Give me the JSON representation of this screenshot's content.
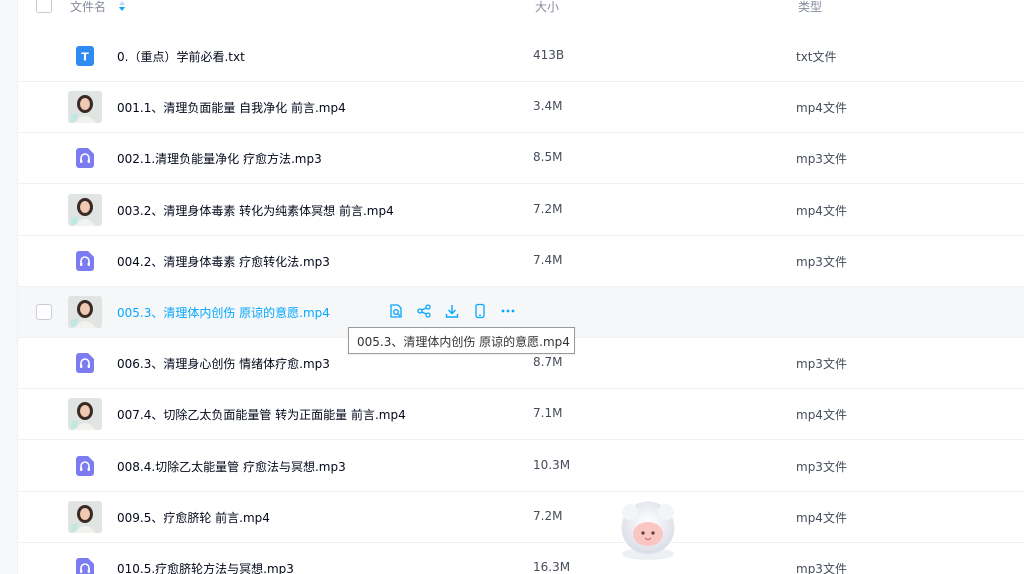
{
  "header": {
    "name_label": "文件名",
    "size_label": "大小",
    "type_label": "类型"
  },
  "files": [
    {
      "name": "0.（重点）学前必看.txt",
      "size": "413B",
      "type": "txt文件",
      "icon": "text-file-icon"
    },
    {
      "name": "001.1、清理负面能量 自我净化 前言.mp4",
      "size": "3.4M",
      "type": "mp4文件",
      "icon": "video-thumbnail"
    },
    {
      "name": "002.1.清理负能量净化 疗愈方法.mp3",
      "size": "8.5M",
      "type": "mp3文件",
      "icon": "audio-file-icon"
    },
    {
      "name": "003.2、清理身体毒素 转化为纯素体冥想 前言.mp4",
      "size": "7.2M",
      "type": "mp4文件",
      "icon": "video-thumbnail"
    },
    {
      "name": "004.2、清理身体毒素 疗愈转化法.mp3",
      "size": "7.4M",
      "type": "mp3文件",
      "icon": "audio-file-icon"
    },
    {
      "name": "005.3、清理体内创伤 原谅的意愿.mp4",
      "size": "",
      "type": "",
      "icon": "video-thumbnail"
    },
    {
      "name": "006.3、清理身心创伤 情绪体疗愈.mp3",
      "size": "8.7M",
      "type": "mp3文件",
      "icon": "audio-file-icon"
    },
    {
      "name": "007.4、切除乙太负面能量管 转为正面能量 前言.mp4",
      "size": "7.1M",
      "type": "mp4文件",
      "icon": "video-thumbnail"
    },
    {
      "name": "008.4.切除乙太能量管 疗愈法与冥想.mp3",
      "size": "10.3M",
      "type": "mp3文件",
      "icon": "audio-file-icon"
    },
    {
      "name": "009.5、疗愈脐轮 前言.mp4",
      "size": "7.2M",
      "type": "mp4文件",
      "icon": "video-thumbnail"
    },
    {
      "name": "010.5.疗愈脐轮方法与冥想.mp3",
      "size": "16.3M",
      "type": "mp3文件",
      "icon": "audio-file-icon"
    }
  ],
  "hovered_row": 5,
  "hover_actions": [
    "preview-icon",
    "share-icon",
    "download-icon",
    "phone-icon",
    "more-icon"
  ],
  "tooltip": {
    "text": "005.3、清理体内创伤 原谅的意愿.mp4"
  },
  "colors": {
    "accent": "#06a7ff",
    "text_icon": "#2f8bf0",
    "audio_icon": "#7c7bf2"
  }
}
